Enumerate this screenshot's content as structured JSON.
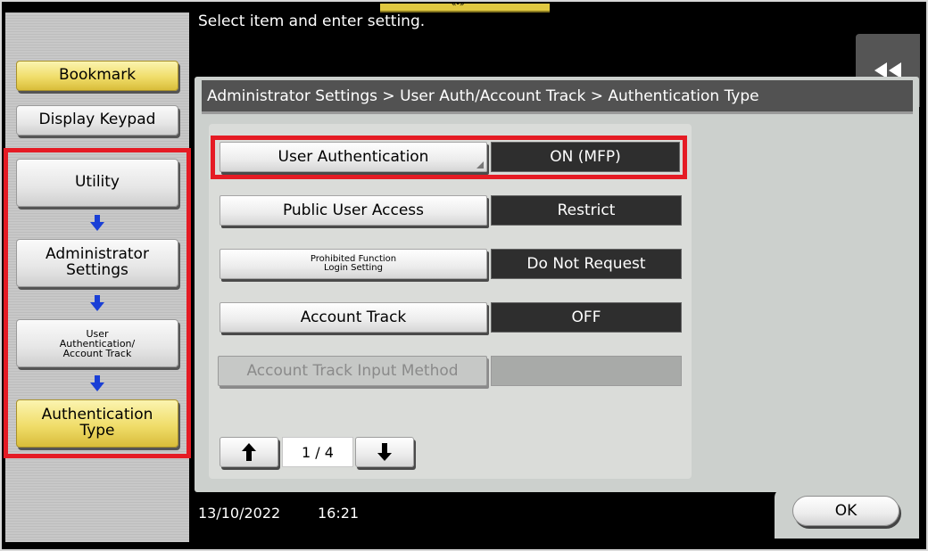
{
  "header": {
    "message": "Select item and enter setting."
  },
  "top_handle": {
    "glyph": "«•»"
  },
  "back_button": {
    "icon": "double-left-arrow-icon"
  },
  "left": {
    "bookmark_label": "Bookmark",
    "display_keypad_label": "Display Keypad",
    "path": [
      {
        "label": "Utility"
      },
      {
        "label": "Administrator\nSettings"
      },
      {
        "label": "User\nAuthentication/\nAccount Track"
      },
      {
        "label": "Authentication\nType"
      }
    ]
  },
  "breadcrumb": "Administrator Settings > User Auth/Account Track > Authentication Type",
  "settings": [
    {
      "label": "User Authentication",
      "value": "ON (MFP)"
    },
    {
      "label": "Public User Access",
      "value": "Restrict"
    },
    {
      "label": "Prohibited Function\nLogin Setting",
      "value": "Do Not Request"
    },
    {
      "label": "Account Track",
      "value": "OFF"
    },
    {
      "label": "Account Track Input Method",
      "value": ""
    }
  ],
  "pager": {
    "indicator": "1 / 4"
  },
  "status": {
    "date": "13/10/2022",
    "time": "16:21"
  },
  "ok_label": "OK",
  "colors": {
    "highlight": "#e51b24",
    "selected": "#f0dd6a",
    "value_bg": "#2e2e2e"
  }
}
